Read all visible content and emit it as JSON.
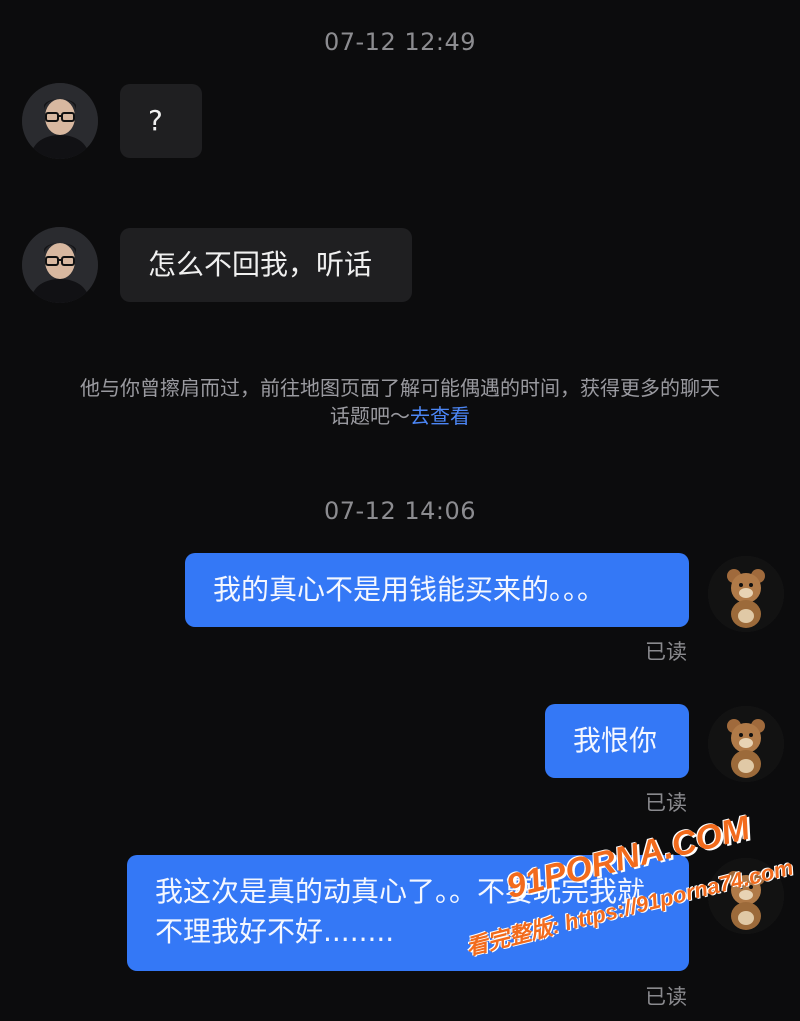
{
  "chat": {
    "timestamp_1": "07-12 12:49",
    "timestamp_2": "07-12 14:06",
    "incoming": [
      {
        "text": "?"
      },
      {
        "text": "怎么不回我，听话"
      }
    ],
    "notice": {
      "text": "他与你曾擦肩而过，前往地图页面了解可能偶遇的时间，获得更多的聊天话题吧～",
      "link": "去查看"
    },
    "outgoing": [
      {
        "text": "我的真心不是用钱能买来的。。。",
        "status": "已读"
      },
      {
        "text": "我恨你",
        "status": "已读"
      },
      {
        "text": "我这次是真的动真心了。。不要玩完我就不理我好不好........",
        "status": "已读"
      }
    ]
  },
  "watermark": {
    "logo": "91PORNA.COM",
    "url": "https://91porna74.com",
    "prefix": "看完整版:"
  },
  "colors": {
    "background": "#0c0c0d",
    "incoming_bubble": "#1f1f21",
    "outgoing_bubble": "#3478f6",
    "link": "#4c86f5",
    "watermark_orange": "#f26b1d"
  },
  "icons": {
    "contact_avatar": "man-with-glasses-avatar",
    "self_avatar": "teddy-bear-avatar"
  }
}
